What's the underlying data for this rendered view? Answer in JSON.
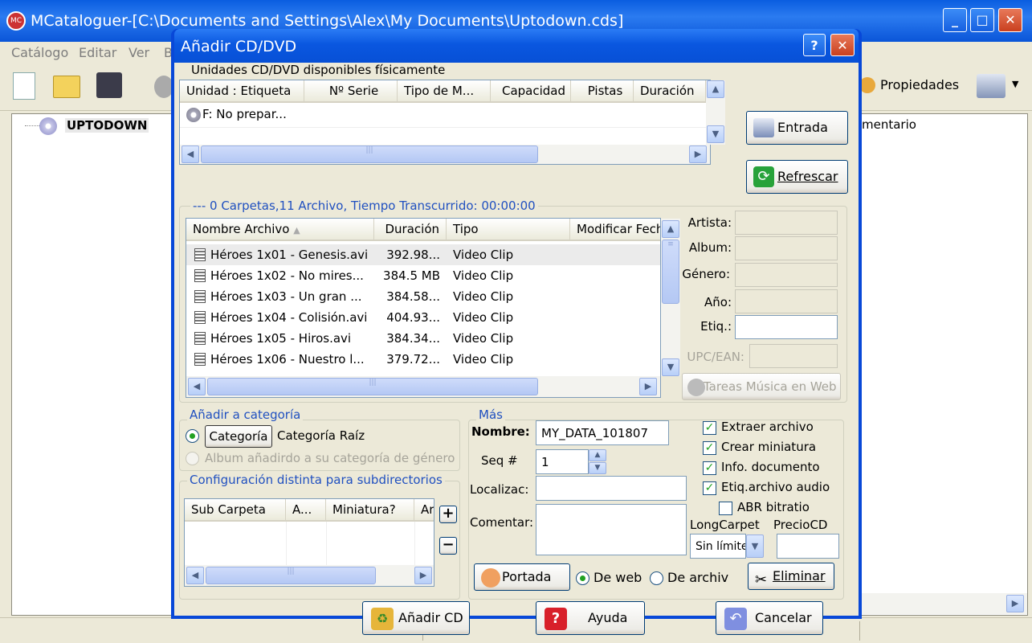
{
  "main": {
    "title": "MCataloguer-[C:\\Documents and Settings\\Alex\\My Documents\\Uptodown.cds]",
    "menu": [
      "Catálogo",
      "Editar",
      "Ver",
      "B"
    ],
    "toolbar_right": "Propiedades",
    "tree_root": "UPTODOWN",
    "right_header": "mentario",
    "app_icon": "MC"
  },
  "dialog": {
    "title": "Añadir CD/DVD",
    "drives_label": "Unidades CD/DVD disponibles físicamente",
    "drive_columns": [
      "Unidad : Etiqueta",
      "Nº Serie",
      "Tipo de M...",
      "Capacidad",
      "Pistas",
      "Duración"
    ],
    "drive_row": "F: No prepar...",
    "entrada": "Entrada",
    "refrescar": "Refrescar",
    "summary": "--- 0 Carpetas,11 Archivo, Tiempo Transcurrido: 00:00:00",
    "file_columns": [
      "Nombre Archivo",
      "Duración",
      "Tipo",
      "Modificar Fech"
    ],
    "files": [
      {
        "name": "Héroes 1x01 - Genesis.avi",
        "size": "392.98...",
        "type": "Video Clip"
      },
      {
        "name": "Héroes 1x02 - No mires...",
        "size": "384.5 MB",
        "type": "Video Clip"
      },
      {
        "name": "Héroes 1x03 - Un gran ...",
        "size": "384.58...",
        "type": "Video Clip"
      },
      {
        "name": "Héroes 1x04 - Colisión.avi",
        "size": "404.93...",
        "type": "Video Clip"
      },
      {
        "name": "Héroes 1x05 - Hiros.avi",
        "size": "384.34...",
        "type": "Video Clip"
      },
      {
        "name": "Héroes 1x06 - Nuestro l...",
        "size": "379.72...",
        "type": "Video Clip"
      }
    ],
    "meta_labels": [
      "Artista:",
      "Album:",
      "Género:",
      "Año:",
      "Etiq.:",
      "UPC/EAN:"
    ],
    "tareas": "Tareas Música en Web",
    "cat_group": "Añadir a categoría",
    "cat_button": "Categoría",
    "cat_value": "Categoría Raíz",
    "cat_genre": "Album añadirdo a su categoría de género",
    "sub_group": "Configuración distinta para subdirectorios",
    "sub_columns": [
      "Sub Carpeta",
      "A...",
      "Miniatura?",
      "Ar"
    ],
    "mas_group": "Más",
    "nombre_label": "Nombre:",
    "nombre_value": "MY_DATA_101807",
    "seq_label": "Seq #",
    "seq_value": "1",
    "localiz_label": "Localizac:",
    "comentar_label": "Comentar:",
    "checks": [
      {
        "label": "Extraer archivo",
        "checked": true
      },
      {
        "label": "Crear miniatura",
        "checked": true
      },
      {
        "label": "Info. documento",
        "checked": true
      },
      {
        "label": "Etiq.archivo audio",
        "checked": true
      },
      {
        "label": "ABR bitratio",
        "checked": false
      }
    ],
    "longcarpet_label": "LongCarpet",
    "longcarpet_value": "Sin límite",
    "precio_label": "PrecioCD",
    "portada": "Portada",
    "de_web": "De web",
    "de_archiv": "De archiv",
    "eliminar": "Eliminar",
    "add_cd": "Añadir CD",
    "ayuda": "Ayuda",
    "cancelar": "Cancelar"
  }
}
